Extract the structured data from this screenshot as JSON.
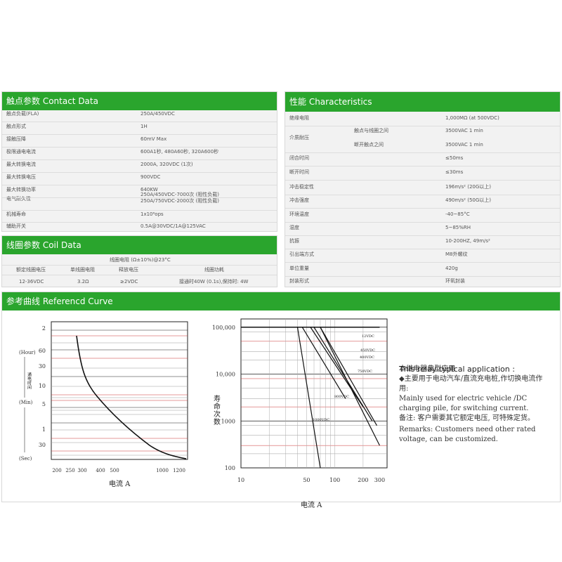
{
  "contact": {
    "title": "触点参数 Contact Data",
    "rows": [
      {
        "label": "触点负载(FLA)",
        "value": "250A/450VDC"
      },
      {
        "label": "触点形式",
        "value": "1H"
      },
      {
        "label": "接触压降",
        "value": "60mV Max"
      },
      {
        "label": "极限通电电流",
        "value": "600A1秒, 480A60秒, 320A600秒"
      },
      {
        "label": "最大转换电流",
        "value": "2000A, 320VDC (1次)"
      },
      {
        "label": "最大转换电压",
        "value": "900VDC"
      },
      {
        "label": "最大转换功率",
        "value": "640KW"
      },
      {
        "label": "电气耐久性",
        "value": "250A/450VDC-7000次 (阻性负载)\n250A/750VDC-2000次 (阻性负载)"
      },
      {
        "label": "机械寿命",
        "value": "1x10⁶ops"
      },
      {
        "label": "辅助开关",
        "value": "0.5A@30VDC/1A@125VAC"
      }
    ]
  },
  "coil": {
    "title": "线圈参数 Coil Data",
    "top_header": "线圈电阻 (Ω±10%)@23°C",
    "headers": [
      "额定线圈电压",
      "单线圈电阻",
      "释放电压",
      "线圈功耗"
    ],
    "row": [
      "12-36VDC",
      "3.2Ω",
      "≥2VDC",
      "接通时40W (0.1s),保持时: 4W"
    ]
  },
  "characteristics": {
    "title": "性能 Characteristics",
    "rows": [
      {
        "label": "绝缘电阻",
        "sub": "",
        "value": "1,000MΩ (at 500VDC)"
      },
      {
        "label": "介质耐压",
        "sub": "触点与线圈之间",
        "value": "3500VAC 1 min"
      },
      {
        "label": "",
        "sub": "断开触点之间",
        "value": "3500VAC 1 min"
      },
      {
        "label": "闭合时间",
        "sub": "",
        "value": "≤50ms"
      },
      {
        "label": "断开时间",
        "sub": "",
        "value": "≤30ms"
      },
      {
        "label": "冲击稳定性",
        "sub": "",
        "value": "196m/s² (20G以上)"
      },
      {
        "label": "冲击强度",
        "sub": "",
        "value": "490m/s² (50G以上)"
      },
      {
        "label": "环境温度",
        "sub": "",
        "value": "-40~85°C"
      },
      {
        "label": "湿度",
        "sub": "",
        "value": "5~85%RH"
      },
      {
        "label": "抗振",
        "sub": "",
        "value": "10-200HZ, 49m/s²"
      },
      {
        "label": "引出端方式",
        "sub": "",
        "value": "M8外螺纹"
      },
      {
        "label": "单位重量",
        "sub": "",
        "value": "420g"
      },
      {
        "label": "封装形式",
        "sub": "",
        "value": "环氧封装"
      }
    ]
  },
  "curve": {
    "title": "参考曲线 Referencd Curve"
  },
  "chart_data": [
    {
      "type": "line",
      "title": "",
      "xlabel": "电流 A",
      "ylabel": "通电时间",
      "x_ticks": [
        "200",
        "250",
        "300",
        "400",
        "500",
        "1000",
        "1200"
      ],
      "y_ticks": [
        "2",
        "60",
        "30",
        "10",
        "5",
        "1",
        "30"
      ],
      "y_unit_labels": [
        "(Hour)",
        "(Min)",
        "(Sec)"
      ],
      "series": [
        {
          "x": [
            250,
            300,
            400,
            500,
            700,
            1000,
            1200
          ],
          "y_label": [
            "≈4 Hour",
            "≈30 Min",
            "≈9 Min",
            "≈4 Min",
            "≈1.5 Min",
            "≈40 Sec",
            "≈30 Sec"
          ]
        }
      ]
    },
    {
      "type": "line",
      "title": "",
      "xlabel": "电流 A",
      "ylabel": "寿命次数",
      "x_ticks": [
        "10",
        "50",
        "100",
        "200",
        "300"
      ],
      "y_ticks": [
        "100,000",
        "10,000",
        "1000",
        "100"
      ],
      "x_scale": "log",
      "y_scale": "log",
      "series_labels": [
        "12VDC",
        "450VDC",
        "400VDC",
        "750VDC",
        "800VDC",
        "1000VDC"
      ],
      "series": [
        {
          "name": "12VDC",
          "x": [
            70,
            300
          ],
          "y": [
            100000,
            300
          ]
        },
        {
          "name": "450VDC",
          "x": [
            70,
            280
          ],
          "y": [
            100000,
            800
          ]
        },
        {
          "name": "400VDC",
          "x": [
            60,
            250
          ],
          "y": [
            100000,
            1000
          ]
        },
        {
          "name": "750VDC",
          "x": [
            55,
            200
          ],
          "y": [
            100000,
            2000
          ]
        },
        {
          "name": "800VDC",
          "x": [
            45,
            130
          ],
          "y": [
            100000,
            3000
          ]
        },
        {
          "name": "1000VDC",
          "x": [
            40,
            70
          ],
          "y": [
            100000,
            100
          ]
        }
      ]
    }
  ],
  "application": {
    "title_cn": "本继电器典型应用",
    "title_en": "This relay typical application :",
    "cn1": "◆主要用于电动汽车/直流充电桩,作切换电流作用:",
    "en1": "Mainly used for electric vehicle /DC charging pile, for switching current.",
    "cn2": "备注: 客户需要其它额定电压, 可特殊定货。",
    "en2": "Remarks: Customers need other rated voltage, can be customized."
  }
}
